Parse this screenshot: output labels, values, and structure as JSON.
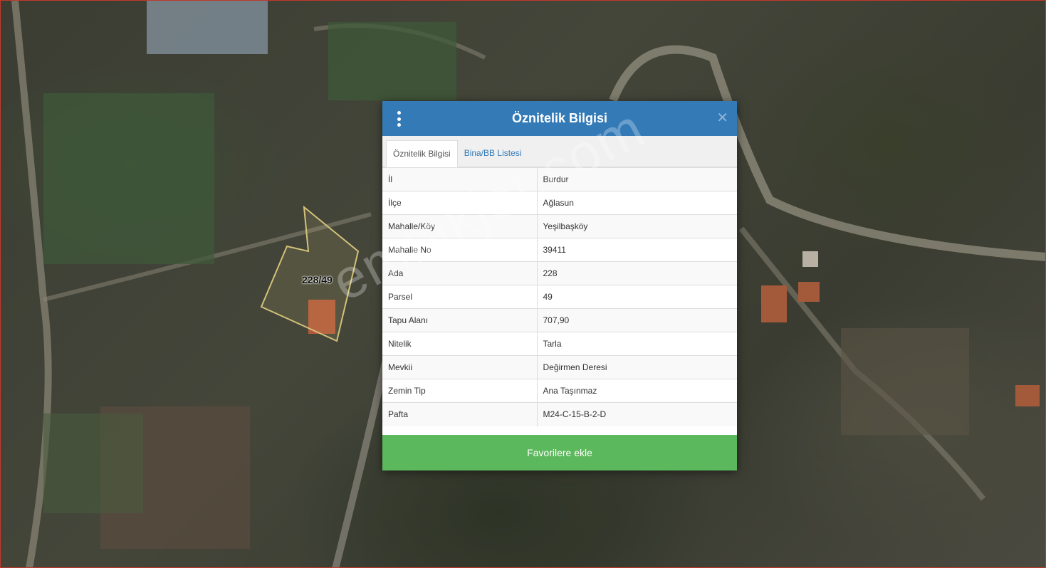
{
  "map": {
    "parcel_label": "228/49",
    "watermark": "emlakjet.com"
  },
  "dialog": {
    "title": "Öznitelik Bilgisi",
    "tabs": [
      {
        "label": "Öznitelik Bilgisi",
        "active": true
      },
      {
        "label": "Bina/BB Listesi",
        "active": false
      }
    ],
    "rows": [
      {
        "key": "İl",
        "value": "Burdur"
      },
      {
        "key": "İlçe",
        "value": "Ağlasun"
      },
      {
        "key": "Mahalle/Köy",
        "value": "Yeşilbaşköy"
      },
      {
        "key": "Mahalle No",
        "value": "39411"
      },
      {
        "key": "Ada",
        "value": "228"
      },
      {
        "key": "Parsel",
        "value": "49"
      },
      {
        "key": "Tapu Alanı",
        "value": "707,90"
      },
      {
        "key": "Nitelik",
        "value": "Tarla"
      },
      {
        "key": "Mevkii",
        "value": "Değirmen Deresi"
      },
      {
        "key": "Zemin Tip",
        "value": "Ana Taşınmaz"
      },
      {
        "key": "Pafta",
        "value": "M24-C-15-B-2-D"
      }
    ],
    "favorite_button": "Favorilere ekle"
  },
  "colors": {
    "header": "#337ab7",
    "button": "#5cb85c",
    "parcel_outline": "#d4c27a"
  },
  "icons": {
    "menu": "vertical-ellipsis-icon",
    "close": "close-icon"
  }
}
